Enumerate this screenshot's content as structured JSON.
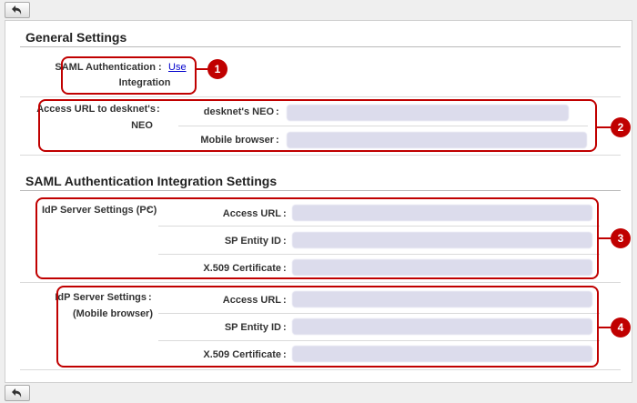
{
  "general": {
    "title": "General Settings",
    "saml_label_line1": "SAML Authentication",
    "saml_label_line2": "Integration",
    "saml_link": "Use",
    "access_url_label_line1": "Access URL to desknet's",
    "access_url_label_line2": "NEO",
    "desknets_neo_label": "desknet's NEO",
    "mobile_browser_label": "Mobile browser"
  },
  "saml": {
    "title": "SAML Authentication Integration Settings",
    "idp_pc_label": "IdP Server Settings (PC)",
    "idp_mobile_label_line1": "IdP Server Settings",
    "idp_mobile_label_line2": "(Mobile browser)",
    "access_url_label": "Access URL",
    "sp_entity_label": "SP Entity ID",
    "x509_label": "X.509 Certificate"
  },
  "separator": ":",
  "badges": [
    "1",
    "2",
    "3",
    "4"
  ],
  "colors": {
    "highlight": "#c00000",
    "link": "#0000cc",
    "field": "#dcdcec"
  },
  "icons": {
    "back": "back-arrow-icon"
  }
}
